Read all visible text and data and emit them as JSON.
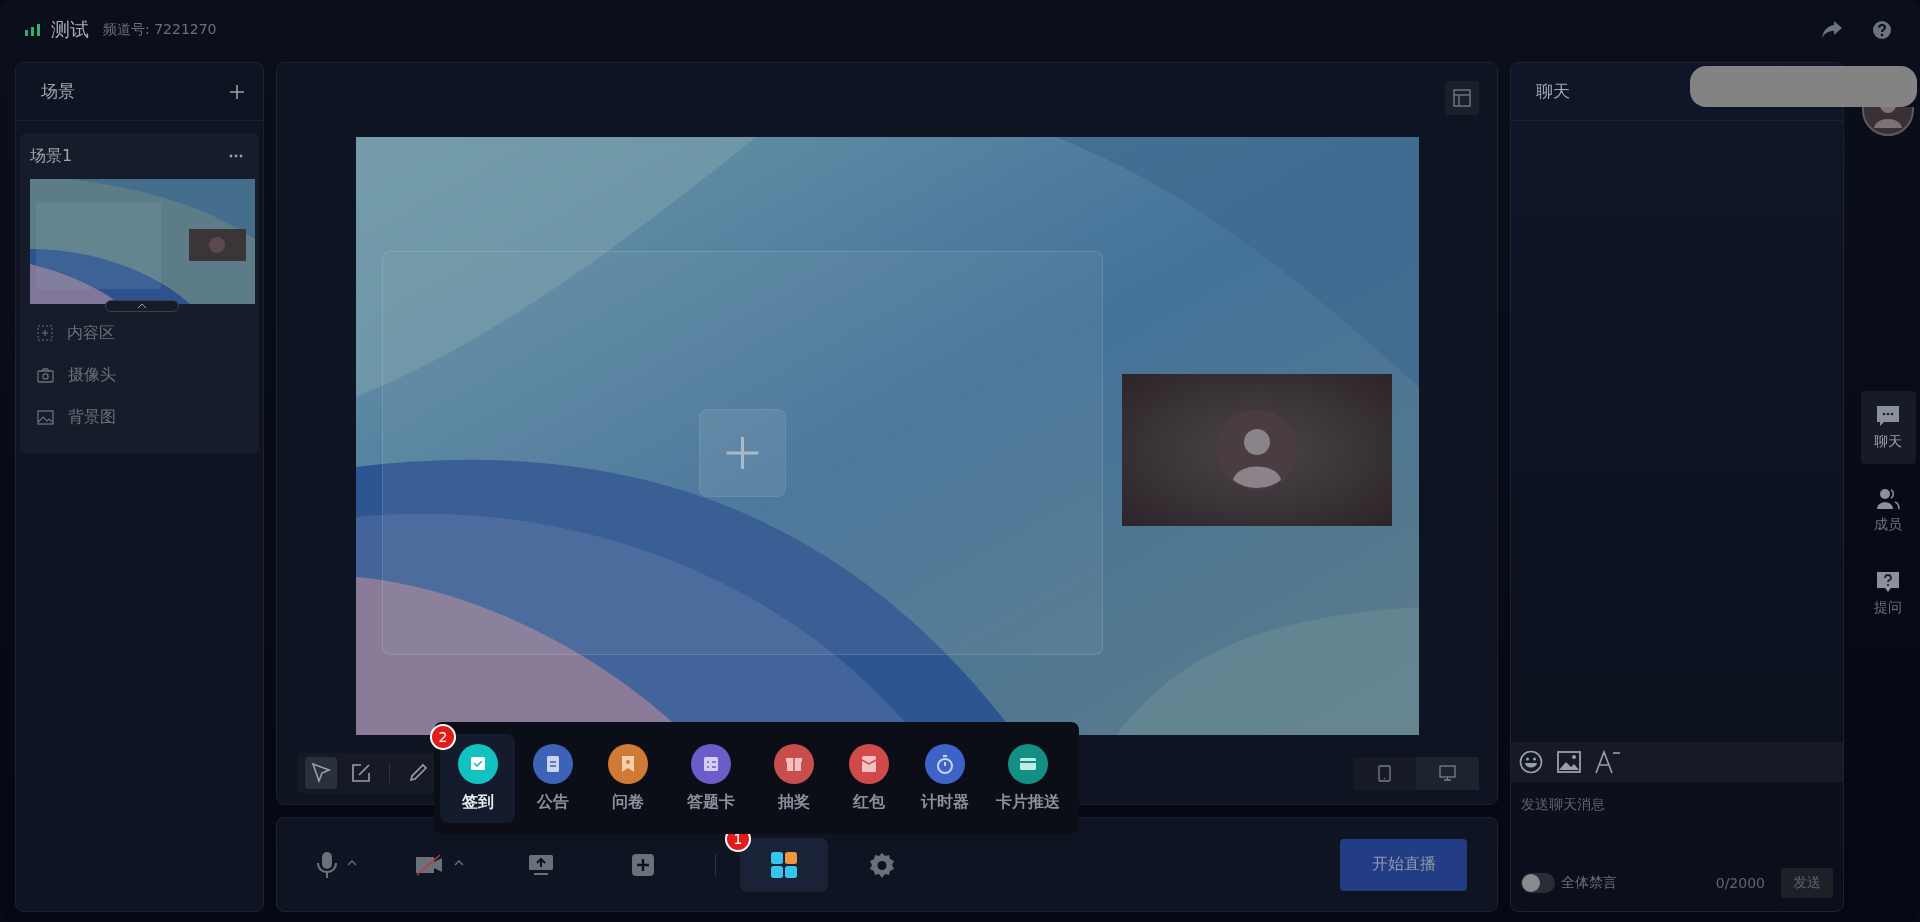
{
  "header": {
    "title": "测试",
    "channel": "频道号: 7221270"
  },
  "scenes": {
    "title": "场景",
    "items": [
      {
        "name": "场景1",
        "layers": [
          {
            "kind": "content",
            "label": "内容区"
          },
          {
            "kind": "camera",
            "label": "摄像头"
          },
          {
            "kind": "background",
            "label": "背景图"
          }
        ]
      }
    ]
  },
  "stage_tools": [
    {
      "kind": "select",
      "selected": true
    },
    {
      "kind": "note",
      "selected": false
    },
    {
      "kind": "pen",
      "selected": false
    }
  ],
  "device_toggle": [
    {
      "kind": "tablet",
      "selected": false
    },
    {
      "kind": "desktop",
      "selected": true
    }
  ],
  "controls": [
    {
      "kind": "mic",
      "caret": true,
      "selected": false
    },
    {
      "kind": "camera-off",
      "caret": true,
      "selected": false
    },
    {
      "kind": "share",
      "caret": false,
      "selected": false
    },
    {
      "kind": "add",
      "caret": false,
      "selected": false
    },
    {
      "kind": "apps",
      "caret": false,
      "selected": true,
      "step": "1"
    },
    {
      "kind": "settings",
      "caret": false,
      "selected": false
    }
  ],
  "start_button": "开始直播",
  "apps_popup": {
    "step": "2",
    "items": [
      {
        "kind": "checkin",
        "label": "签到",
        "color": "#14c1c1",
        "selected": true
      },
      {
        "kind": "notice",
        "label": "公告",
        "color": "#3d63b8",
        "selected": false
      },
      {
        "kind": "survey",
        "label": "问卷",
        "color": "#d07a35",
        "selected": false
      },
      {
        "kind": "quiz",
        "label": "答题卡",
        "color": "#6b5cc9",
        "selected": false
      },
      {
        "kind": "lottery",
        "label": "抽奖",
        "color": "#c84e4e",
        "selected": false
      },
      {
        "kind": "redpacket",
        "label": "红包",
        "color": "#d04a4a",
        "selected": false
      },
      {
        "kind": "timer",
        "label": "计时器",
        "color": "#3d63c8",
        "selected": false
      },
      {
        "kind": "card",
        "label": "卡片推送",
        "color": "#138f86",
        "selected": false
      }
    ]
  },
  "chat": {
    "title": "聊天",
    "placeholder": "发送聊天消息",
    "mute_all": {
      "label": "全体禁言",
      "on": false
    },
    "counter": "0/2000",
    "send": "发送"
  },
  "rail": [
    {
      "kind": "chat",
      "label": "聊天",
      "selected": true
    },
    {
      "kind": "members",
      "label": "成员",
      "selected": false
    },
    {
      "kind": "question",
      "label": "提问",
      "selected": false
    }
  ]
}
